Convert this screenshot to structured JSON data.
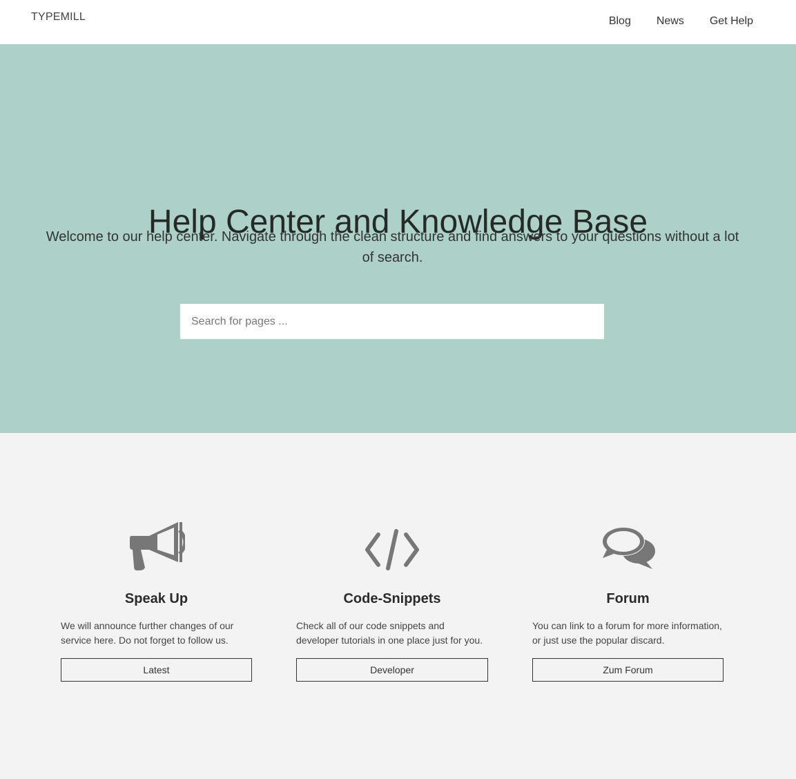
{
  "header": {
    "logo": "TYPEMILL",
    "nav": [
      {
        "label": "Blog"
      },
      {
        "label": "News"
      },
      {
        "label": "Get Help"
      }
    ]
  },
  "hero": {
    "title": "Help Center and Knowledge Base",
    "subtitle": "Welcome to our help center. Navigate through the clean structure and find answers to your questions without a lot of search.",
    "search": {
      "placeholder": "Search for pages ...",
      "value": ""
    },
    "background_color": "#add1c8"
  },
  "features": [
    {
      "icon": "megaphone-icon",
      "title": "Speak Up",
      "text": "We will announce further changes of our service here. Do not forget to follow us.",
      "button": "Latest"
    },
    {
      "icon": "code-icon",
      "title": "Code-Snippets",
      "text": "Check all of our code snippets and developer tutorials in one place just for you.",
      "button": "Developer"
    },
    {
      "icon": "chat-bubbles-icon",
      "title": "Forum",
      "text": "You can link to a forum for more information, or just use the popular discard.",
      "button": "Zum Forum"
    }
  ],
  "colors": {
    "icon": "#777777",
    "page_background": "#f3f3f3"
  }
}
